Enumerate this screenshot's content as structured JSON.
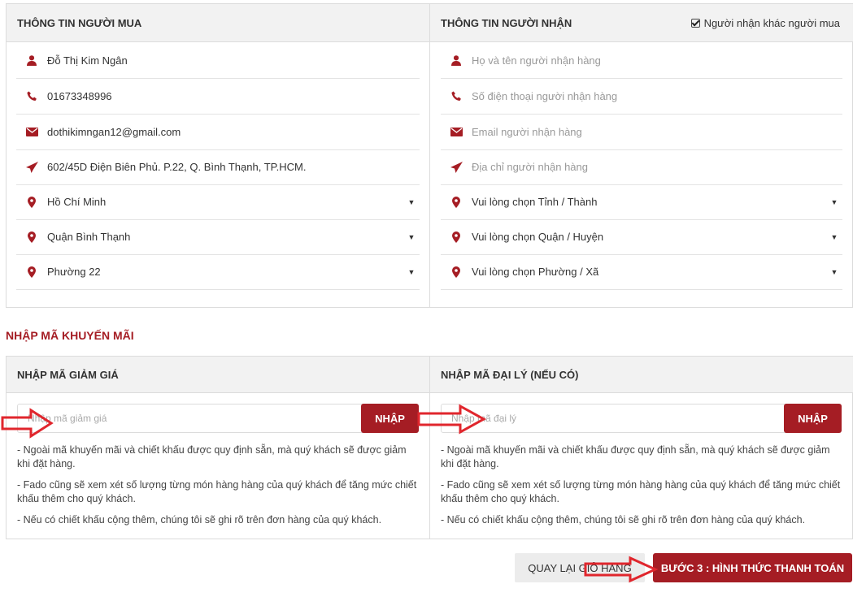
{
  "buyer": {
    "title": "THÔNG TIN NGƯỜI MUA",
    "name": "Đỗ Thị Kim Ngân",
    "phone": "01673348996",
    "email": "dothikimngan12@gmail.com",
    "address": "602/45D Điện Biên Phủ. P.22, Q. Bình Thạnh, TP.HCM.",
    "city": "Hồ Chí Minh",
    "district": "Quận Bình Thạnh",
    "ward": "Phường 22"
  },
  "receiver": {
    "title": "THÔNG TIN NGƯỜI NHẬN",
    "checkbox_label": "Người nhận khác người mua",
    "name_placeholder": "Họ và tên người nhận hàng",
    "phone_placeholder": "Số điện thoại người nhận hàng",
    "email_placeholder": "Email người nhận hàng",
    "address_placeholder": "Địa chỉ người nhận hàng",
    "city_placeholder": "Vui lòng chọn Tỉnh / Thành",
    "district_placeholder": "Vui lòng chọn Quận / Huyện",
    "ward_placeholder": "Vui lòng chọn Phường / Xã"
  },
  "promo": {
    "section_title": "NHẬP MÃ KHUYẾN MÃI",
    "discount_title": "NHẬP MÃ GIẢM GIÁ",
    "discount_placeholder": "Nhập mã giảm giá",
    "agent_title": "NHẬP MÃ ĐẠI LÝ (NẾU CÓ)",
    "agent_placeholder": "Nhập mã đại lý",
    "apply_label": "NHẬP",
    "notes": [
      "- Ngoài mã khuyến mãi và chiết khấu được quy định sẵn, mà quý khách sẽ được giảm khi đặt hàng.",
      "- Fado cũng sẽ xem xét số lượng từng món hàng hàng của quý khách để tăng mức chiết khấu thêm cho quý khách.",
      "- Nếu có chiết khấu cộng thêm, chúng tôi sẽ ghi rõ trên đơn hàng của quý khách."
    ]
  },
  "actions": {
    "back_label": "QUAY LẠI GIỎ HÀNG",
    "next_label": "BƯỚC 3 : HÌNH THỨC THANH TOÁN"
  },
  "colors": {
    "accent": "#a51d24",
    "header_bg": "#f2f2f2",
    "annotation": "#e0262d"
  }
}
